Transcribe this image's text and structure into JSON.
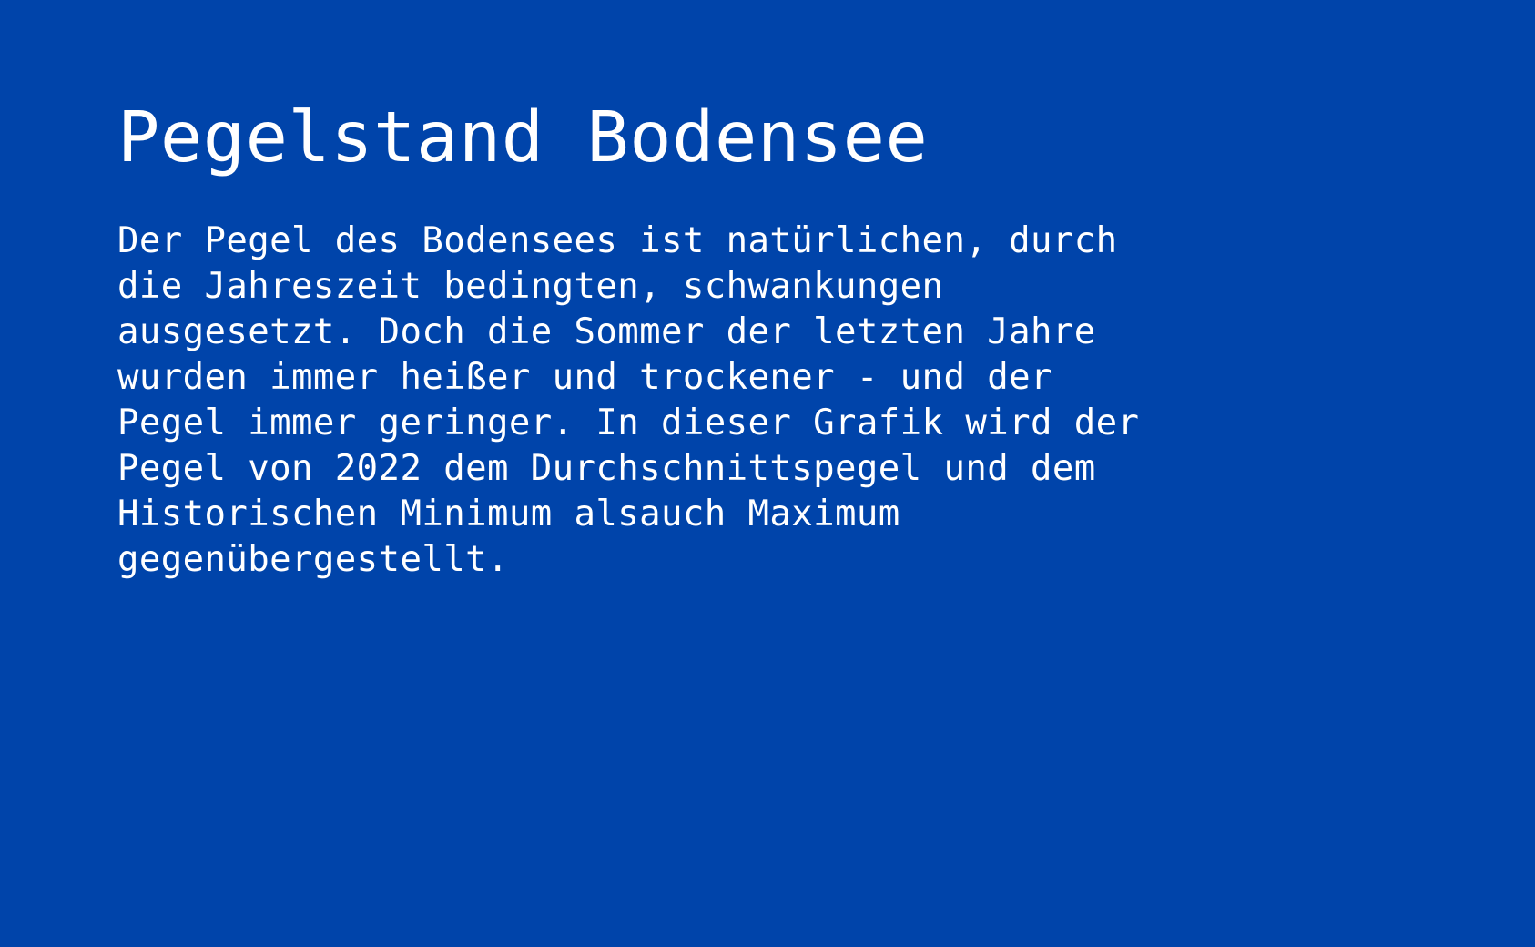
{
  "page": {
    "background_color": "#0044aa",
    "text_color": "#ffffff",
    "title": "Pegelstand Bodensee",
    "intro_lines": [
      "Der Pegel des Bodensees ist natürlichen, durch",
      "die Jahreszeit bedingten, schwankungen",
      "ausgesetzt. Doch die Sommer der letzten Jahre",
      "wurden immer heißer und trockener - und der",
      "Pegel immer geringer. In dieser Grafik wird der",
      "Pegel von 2022 dem Durchschnittspegel und dem",
      "Historischen Minimum alsauch Maximum",
      "gegenübergestellt."
    ]
  }
}
